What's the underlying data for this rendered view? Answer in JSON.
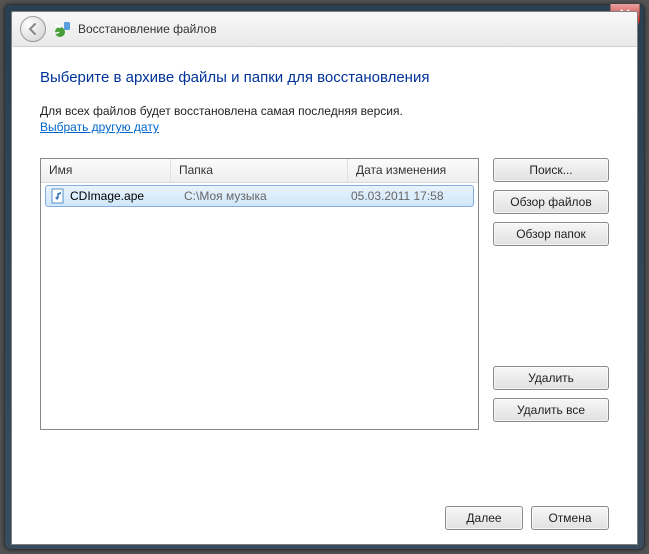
{
  "window": {
    "title": "Восстановление файлов"
  },
  "page": {
    "heading": "Выберите в архиве файлы и папки для восстановления",
    "subtext": "Для всех файлов будет восстановлена самая последняя версия.",
    "link_choose_date": "Выбрать другую дату"
  },
  "columns": {
    "name": "Имя",
    "folder": "Папка",
    "modified": "Дата изменения"
  },
  "files": [
    {
      "name": "CDImage.ape",
      "folder": "C:\\Моя музыка",
      "modified": "05.03.2011 17:58"
    }
  ],
  "buttons": {
    "search": "Поиск...",
    "browse_files": "Обзор файлов",
    "browse_folders": "Обзор папок",
    "remove": "Удалить",
    "remove_all": "Удалить все",
    "next": "Далее",
    "cancel": "Отмена"
  }
}
